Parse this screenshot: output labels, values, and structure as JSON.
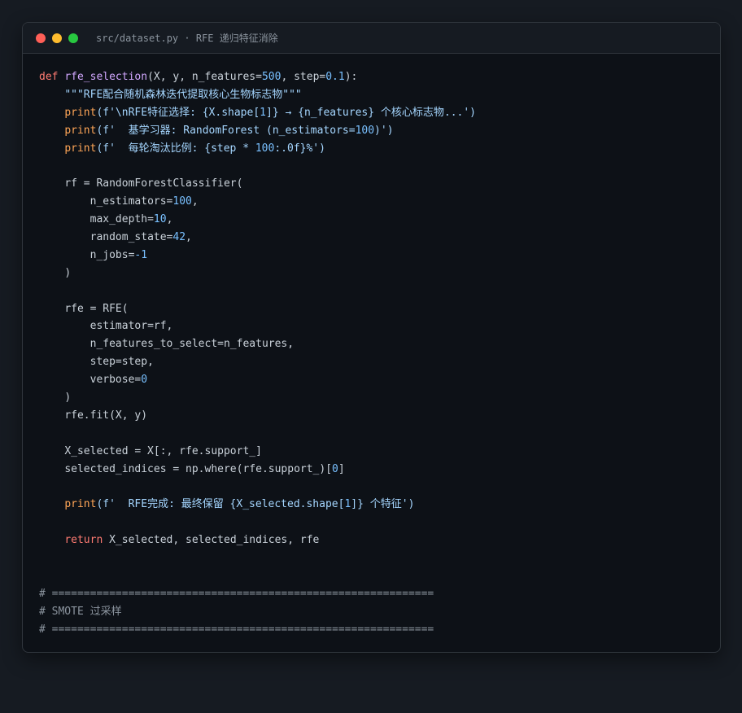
{
  "window": {
    "title": "src/dataset.py · RFE 递归特征消除",
    "traffic_lights": {
      "close": "#ff5f57",
      "minimize": "#febc2e",
      "maximize": "#28c840"
    }
  },
  "colors": {
    "background": "#161b22",
    "editor": "#0d1117",
    "keyword": "#ff7b72",
    "function": "#d2a8ff",
    "number": "#79c0ff",
    "string": "#a5d6ff",
    "comment": "#8b949e",
    "builtin": "#ffa657",
    "text": "#c9d1d9"
  },
  "code": {
    "l1": {
      "kw": "def",
      "fn": "rfe_selection",
      "a": "(X, y, n_features=",
      "n1": "500",
      "b": ", step=",
      "n2": "0.1",
      "c": "):"
    },
    "l2": {
      "doc": "\"\"\"RFE配合随机森林迭代提取核心生物标志物\"\"\""
    },
    "l3": {
      "print": "print",
      "a": "(f'\\nRFE特征选择: {X.shape[",
      "n1": "1",
      "b": "]} → {n_features} 个核心标志物...')"
    },
    "l4": {
      "print": "print",
      "a": "(f'  基学习器: RandomForest (n_estimators=",
      "n1": "100",
      "b": ")')"
    },
    "l5": {
      "print": "print",
      "a": "(f'  每轮淘汰比例: {step * ",
      "n1": "100",
      "b": ":.0f}%')"
    },
    "l7": {
      "text": "rf = RandomForestClassifier("
    },
    "l8": {
      "a": "n_estimators=",
      "n1": "100",
      "b": ","
    },
    "l9": {
      "a": "max_depth=",
      "n1": "10",
      "b": ","
    },
    "l10": {
      "a": "random_state=",
      "n1": "42",
      "b": ","
    },
    "l11": {
      "a": "n_jobs=",
      "n1": "-1"
    },
    "l12": {
      "text": ")"
    },
    "l14": {
      "text": "rfe = RFE("
    },
    "l15": {
      "text": "estimator=rf,"
    },
    "l16": {
      "text": "n_features_to_select=n_features,"
    },
    "l17": {
      "text": "step=step,"
    },
    "l18": {
      "a": "verbose=",
      "n1": "0"
    },
    "l19": {
      "text": ")"
    },
    "l20": {
      "text": "rfe.fit(X, y)"
    },
    "l22": {
      "text": "X_selected = X[:, rfe.support_]"
    },
    "l23": {
      "a": "selected_indices = np.where(rfe.support_)[",
      "n1": "0",
      "b": "]"
    },
    "l25": {
      "print": "print",
      "a": "(f'  RFE完成: 最终保留 {X_selected.shape[",
      "n1": "1",
      "b": "]} 个特征')"
    },
    "l27": {
      "kw": "return",
      "a": " X_selected, selected_indices, rfe"
    },
    "l30": {
      "com": "# ============================================================"
    },
    "l31": {
      "com": "# SMOTE 过采样"
    },
    "l32": {
      "com": "# ============================================================"
    }
  }
}
